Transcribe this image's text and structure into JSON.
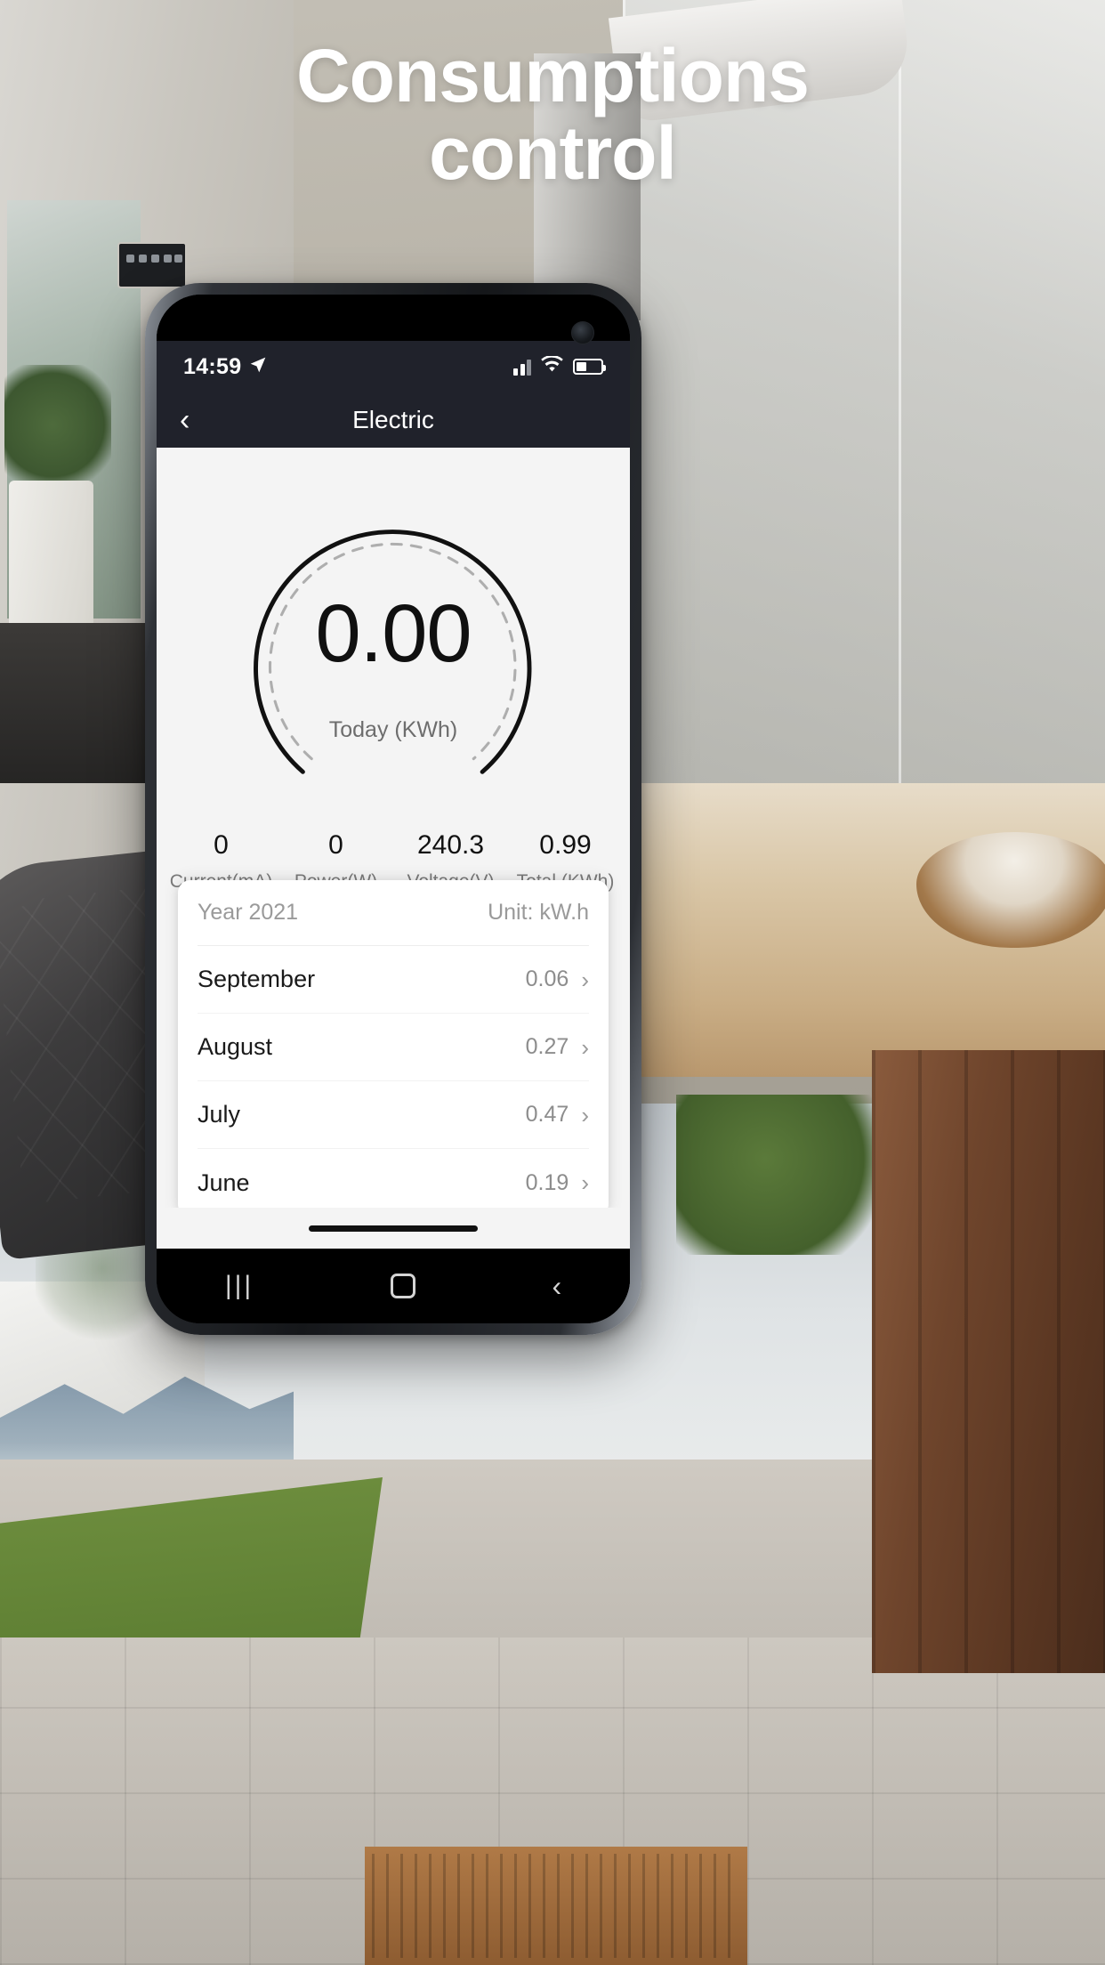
{
  "promo": {
    "headline_line1": "Consumptions",
    "headline_line2": "control"
  },
  "status_bar": {
    "time": "14:59",
    "location_icon": "location-arrow-icon",
    "signal_icon": "cellular-signal-icon",
    "wifi_icon": "wifi-icon",
    "battery_icon": "battery-icon"
  },
  "nav": {
    "back_icon": "chevron-left-icon",
    "title": "Electric"
  },
  "gauge": {
    "value": "0.00",
    "label": "Today (KWh)"
  },
  "metrics": [
    {
      "value": "0",
      "label": "Current(mA)"
    },
    {
      "value": "0",
      "label": "Power(W)"
    },
    {
      "value": "240.3",
      "label": "Voltage(V)"
    },
    {
      "value": "0.99",
      "label": "Total (KWh)"
    }
  ],
  "history": {
    "year_label": "Year 2021",
    "unit_label": "Unit: kW.h",
    "rows": [
      {
        "month": "September",
        "value": "0.06",
        "chevron": "chevron-right-icon"
      },
      {
        "month": "August",
        "value": "0.27",
        "chevron": "chevron-right-icon"
      },
      {
        "month": "July",
        "value": "0.47",
        "chevron": "chevron-right-icon"
      },
      {
        "month": "June",
        "value": "0.19",
        "chevron": "chevron-right-icon"
      }
    ]
  },
  "android_nav": {
    "recent_label": "|||",
    "home_icon": "home-square-icon",
    "back_icon": "back-chevron-icon"
  },
  "colors": {
    "statusbar_bg": "#20222b",
    "app_bg": "#f4f4f4",
    "card_bg": "#ffffff",
    "text_primary": "#111111",
    "text_muted": "#8d8d8d"
  }
}
